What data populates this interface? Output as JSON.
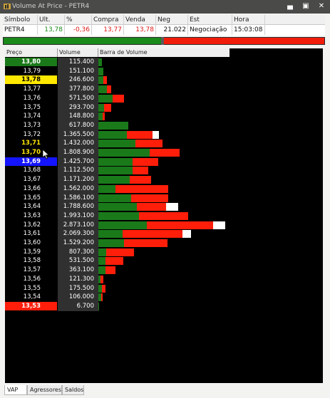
{
  "window": {
    "title": "Volume At Price - PETR4",
    "minimize_glyph": "▄",
    "restore_glyph": "▣",
    "close_glyph": "✕"
  },
  "quote": {
    "headers": [
      "Símbolo",
      "Ult.",
      "%",
      "Compra",
      "Venda",
      "Neg",
      "Est",
      "Hora"
    ],
    "values": [
      "PETR4",
      "13,78",
      "-0,36",
      "13,77",
      "13,78",
      "21.022",
      "Negociação",
      "15:03:08"
    ]
  },
  "colors": {
    "buy": "#1a7a1a",
    "sell": "#ff1e0a",
    "neutral": "#ffffff",
    "last_price": "#ffe800",
    "open_price": "#1a7a1a",
    "close_low": "#ff1e0a",
    "current": "#1414ff"
  },
  "table": {
    "headers": [
      "Preço",
      "Volume",
      "Barra de Volume"
    ],
    "rows": [
      {
        "price": "13,80",
        "volume": "115.400",
        "buy": 5,
        "sell": 0,
        "neutral": 0,
        "mark": "open"
      },
      {
        "price": "13,79",
        "volume": "151.100",
        "buy": 7,
        "sell": 0,
        "neutral": 0,
        "mark": ""
      },
      {
        "price": "13,78",
        "volume": "246.600",
        "buy": 7,
        "sell": 5,
        "neutral": 0,
        "mark": "last"
      },
      {
        "price": "13,77",
        "volume": "377.800",
        "buy": 12,
        "sell": 6,
        "neutral": 0,
        "mark": ""
      },
      {
        "price": "13,76",
        "volume": "571.500",
        "buy": 20,
        "sell": 16,
        "neutral": 0,
        "mark": ""
      },
      {
        "price": "13,75",
        "volume": "293.700",
        "buy": 8,
        "sell": 10,
        "neutral": 0,
        "mark": ""
      },
      {
        "price": "13,74",
        "volume": "148.800",
        "buy": 6,
        "sell": 3,
        "neutral": 0,
        "mark": ""
      },
      {
        "price": "13,73",
        "volume": "617.800",
        "buy": 42,
        "sell": 0,
        "neutral": 0,
        "mark": ""
      },
      {
        "price": "13,72",
        "volume": "1.365.500",
        "buy": 40,
        "sell": 36,
        "neutral": 9,
        "mark": ""
      },
      {
        "price": "13,71",
        "volume": "1.432.000",
        "buy": 52,
        "sell": 38,
        "neutral": 0,
        "mark": "yellow_text"
      },
      {
        "price": "13,70",
        "volume": "1.808.900",
        "buy": 72,
        "sell": 42,
        "neutral": 0,
        "mark": "yellow_text"
      },
      {
        "price": "13,69",
        "volume": "1.425.700",
        "buy": 48,
        "sell": 36,
        "neutral": 0,
        "mark": "current"
      },
      {
        "price": "13,68",
        "volume": "1.112.500",
        "buy": 48,
        "sell": 22,
        "neutral": 0,
        "mark": ""
      },
      {
        "price": "13,67",
        "volume": "1.171.200",
        "buy": 44,
        "sell": 30,
        "neutral": 0,
        "mark": ""
      },
      {
        "price": "13,66",
        "volume": "1.562.000",
        "buy": 24,
        "sell": 74,
        "neutral": 0,
        "mark": ""
      },
      {
        "price": "13,65",
        "volume": "1.586.100",
        "buy": 46,
        "sell": 52,
        "neutral": 0,
        "mark": ""
      },
      {
        "price": "13,64",
        "volume": "1.788.600",
        "buy": 54,
        "sell": 41,
        "neutral": 17,
        "mark": ""
      },
      {
        "price": "13,63",
        "volume": "1.993.100",
        "buy": 57,
        "sell": 69,
        "neutral": 0,
        "mark": ""
      },
      {
        "price": "13,62",
        "volume": "2.873.100",
        "buy": 68,
        "sell": 93,
        "neutral": 17,
        "mark": ""
      },
      {
        "price": "13,61",
        "volume": "2.069.300",
        "buy": 34,
        "sell": 84,
        "neutral": 12,
        "mark": ""
      },
      {
        "price": "13,60",
        "volume": "1.529.200",
        "buy": 36,
        "sell": 61,
        "neutral": 0,
        "mark": ""
      },
      {
        "price": "13,59",
        "volume": "807.300",
        "buy": 11,
        "sell": 39,
        "neutral": 0,
        "mark": ""
      },
      {
        "price": "13,58",
        "volume": "531.500",
        "buy": 10,
        "sell": 25,
        "neutral": 0,
        "mark": ""
      },
      {
        "price": "13,57",
        "volume": "363.100",
        "buy": 10,
        "sell": 14,
        "neutral": 0,
        "mark": ""
      },
      {
        "price": "13,56",
        "volume": "121.300",
        "buy": 3,
        "sell": 4,
        "neutral": 0,
        "mark": ""
      },
      {
        "price": "13,55",
        "volume": "175.500",
        "buy": 5,
        "sell": 5,
        "neutral": 0,
        "mark": ""
      },
      {
        "price": "13,54",
        "volume": "106.000",
        "buy": 4,
        "sell": 2,
        "neutral": 0,
        "mark": ""
      },
      {
        "price": "13,53",
        "volume": "6.700",
        "buy": 1,
        "sell": 0,
        "neutral": 0,
        "mark": "close"
      }
    ]
  },
  "tabs": [
    "VAP",
    "Agressores",
    "Saldos"
  ]
}
